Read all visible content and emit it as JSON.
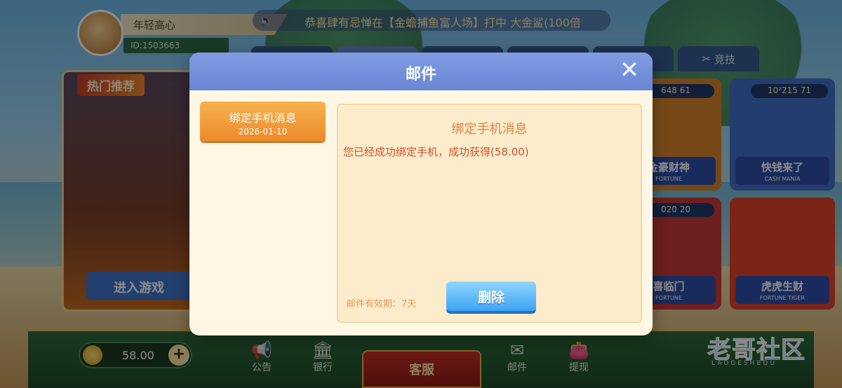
{
  "player": {
    "name": "年轻高心",
    "id": "ID:1503663"
  },
  "marquee": {
    "text": "恭喜肆有忌惮在【金蟾捕鱼富人场】打中 大金鲨(100倍"
  },
  "tabs": [
    {
      "label": ""
    },
    {
      "label": ""
    },
    {
      "label": ""
    },
    {
      "label": ""
    },
    {
      "label": ""
    },
    {
      "label": "竞技"
    }
  ],
  "hot": {
    "title": "热门推荐",
    "enter": "进入游戏"
  },
  "games": [
    {
      "jackpot": "648 61",
      "name": "金豪财神",
      "sub": "FORTUNE"
    },
    {
      "jackpot": "10²215 71",
      "name": "快钱来了",
      "sub": "CASH MANIA"
    },
    {
      "jackpot": "020 20",
      "name": "喜临门",
      "sub": "FORTUNE"
    },
    {
      "jackpot": "",
      "name": "虎虎生财",
      "sub": "FORTUNE TIGER"
    }
  ],
  "balance": {
    "value": "58.00",
    "plus": "+"
  },
  "nav": {
    "notice": "公告",
    "bank": "银行",
    "service": "客服",
    "mail": "邮件",
    "withdraw": "提现"
  },
  "watermark": {
    "text": "老哥社区",
    "sub": "LAOGESHEQU"
  },
  "dialog": {
    "title": "邮件",
    "close": "✕",
    "mail_item": {
      "title": "绑定手机消息",
      "date": "2026-01-10"
    },
    "detail": {
      "title": "绑定手机消息",
      "body": "您已经成功绑定手机，成功获得(58.00)",
      "expire": "邮件有效期：7天",
      "delete": "删除"
    }
  }
}
